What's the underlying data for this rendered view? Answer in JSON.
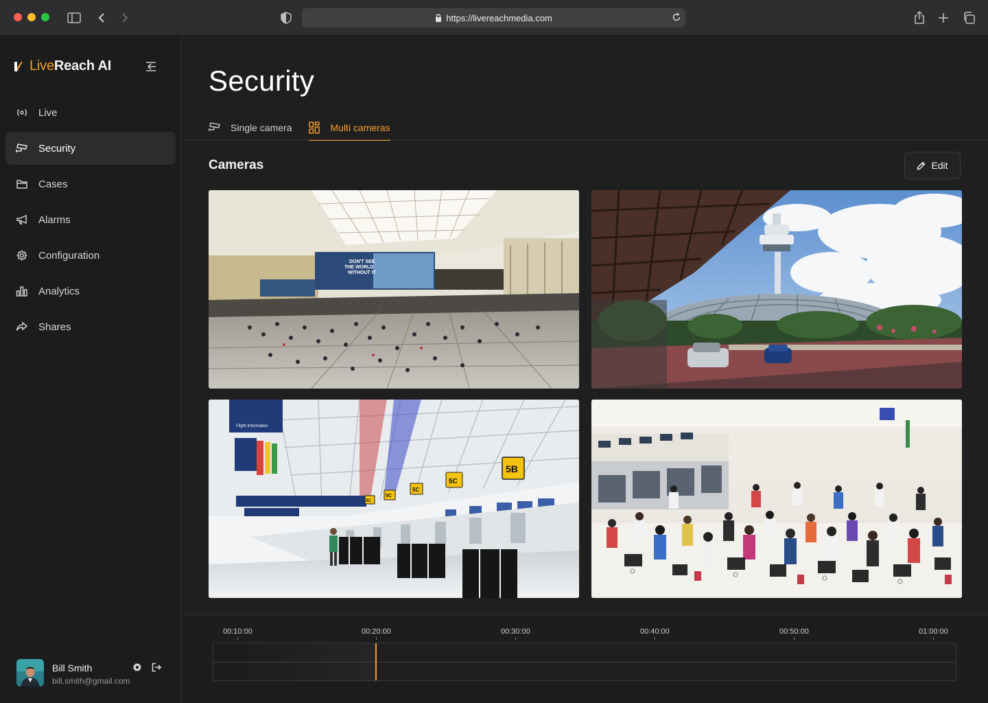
{
  "browser": {
    "url": "https://livereachmedia.com",
    "icons": [
      "sidebar-toggle-icon",
      "back-icon",
      "forward-icon",
      "shield-icon",
      "lock-icon",
      "reload-icon",
      "share-icon",
      "new-tab-icon",
      "tabs-overview-icon"
    ]
  },
  "brand": {
    "part1": "Live",
    "part2": "Reach AI",
    "accent": "#f59e2c"
  },
  "sidebar": {
    "items": [
      {
        "label": "Live",
        "icon": "live-broadcast-icon"
      },
      {
        "label": "Security",
        "icon": "security-camera-icon",
        "active": true
      },
      {
        "label": "Cases",
        "icon": "folder-icon"
      },
      {
        "label": "Alarms",
        "icon": "megaphone-icon"
      },
      {
        "label": "Configuration",
        "icon": "gear-icon"
      },
      {
        "label": "Analytics",
        "icon": "bar-chart-icon"
      },
      {
        "label": "Shares",
        "icon": "share-arrow-icon"
      }
    ]
  },
  "user": {
    "name": "Bill Smith",
    "email": "bill.smith@gmail.com"
  },
  "page": {
    "title": "Security",
    "tabs": [
      {
        "label": "Single camera",
        "icon": "security-camera-icon"
      },
      {
        "label": "Multi cameras",
        "icon": "grid-icon",
        "active": true
      }
    ],
    "section_title": "Cameras",
    "edit_label": "Edit"
  },
  "cameras": [
    {
      "scene": "airport-terminal-hall",
      "billboard": "DON'T SEE THE WORLD WITHOUT IT."
    },
    {
      "scene": "control-tower-exterior"
    },
    {
      "scene": "check-in-counters",
      "signs": [
        "Flight Information",
        "5B",
        "5C",
        "5C",
        "5C",
        "5C"
      ]
    },
    {
      "scene": "crowded-check-in"
    }
  ],
  "timeline": {
    "ticks": [
      "00:10:00",
      "00:20:00",
      "00:30:00",
      "00:40:00",
      "00:50:00",
      "01:00:00"
    ],
    "playhead_time": "00:20:00",
    "progress": 0.218
  }
}
